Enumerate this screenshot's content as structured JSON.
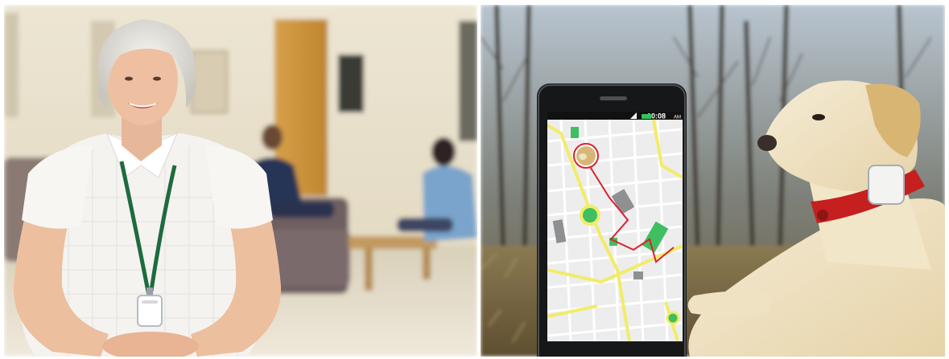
{
  "images": [
    {
      "subject": "senior-woman-with-pendant-tracker"
    },
    {
      "subject": "dog-with-gps-collar-and-smartphone-map"
    }
  ],
  "phone": {
    "status_time": "10:08",
    "status_suffix": "AM"
  },
  "colors": {
    "route": "#d9232e",
    "map_bg": "#ededee",
    "park": "#3fbf5f",
    "main_road": "#f1ec6a",
    "collar": "#c51f1f",
    "lanyard": "#1e6b3e"
  }
}
